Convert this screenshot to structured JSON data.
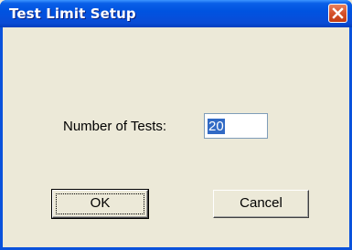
{
  "window": {
    "title": "Test Limit Setup"
  },
  "form": {
    "tests_label": "Number of Tests:",
    "tests_value": "20"
  },
  "buttons": {
    "ok_label": "OK",
    "cancel_label": "Cancel"
  },
  "icons": {
    "close": "close-icon"
  },
  "colors": {
    "titlebar": "#0053e0",
    "close_button": "#d5512a",
    "dialog_background": "#ece9d8",
    "selection_highlight": "#316ac5"
  }
}
